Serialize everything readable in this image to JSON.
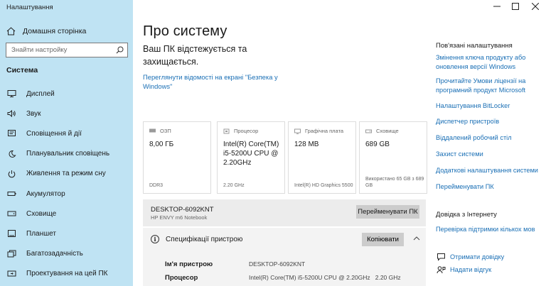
{
  "window": {
    "title": "Налаштування"
  },
  "sidebar": {
    "home_label": "Домашня сторінка",
    "search_placeholder": "Знайти настройку",
    "section_title": "Система",
    "items": [
      {
        "label": "Дисплей",
        "icon": "display-icon"
      },
      {
        "label": "Звук",
        "icon": "sound-icon"
      },
      {
        "label": "Сповіщення й дії",
        "icon": "notifications-icon"
      },
      {
        "label": "Планувальник сповіщень",
        "icon": "moon-icon"
      },
      {
        "label": "Живлення та режим сну",
        "icon": "power-icon"
      },
      {
        "label": "Акумулятор",
        "icon": "battery-icon"
      },
      {
        "label": "Сховище",
        "icon": "storage-icon"
      },
      {
        "label": "Планшет",
        "icon": "tablet-icon"
      },
      {
        "label": "Багатозадачність",
        "icon": "multitasking-icon"
      },
      {
        "label": "Проектування на цей ПК",
        "icon": "projecting-icon"
      }
    ]
  },
  "main": {
    "title": "Про систему",
    "protection_text": "Ваш ПК відстежується та захищається.",
    "security_link": "Переглянути відомості на екрані \"Безпека у Windows\"",
    "cards": [
      {
        "name": "ram",
        "icon": "ram-icon",
        "label": "ОЗП",
        "value": "8,00 ГБ",
        "footer": "DDR3"
      },
      {
        "name": "cpu",
        "icon": "processor-icon",
        "label": "Процесор",
        "value": "Intel(R) Core(TM) i5-5200U CPU @ 2.20GHz",
        "footer": "2.20 GHz"
      },
      {
        "name": "gpu",
        "icon": "graphics-card-icon",
        "label": "Графічна плата",
        "value": "128 MB",
        "footer": "Intel(R) HD Graphics 5500"
      },
      {
        "name": "storage",
        "icon": "drive-icon",
        "label": "Сховище",
        "value": "689 GB",
        "footer": "Використано 65 GB з 689 GB"
      }
    ],
    "device": {
      "name": "DESKTOP-6092KNT",
      "model": "HP ENVY m6 Notebook",
      "rename_label": "Перейменувати ПК"
    },
    "specs": {
      "title": "Специфікації пристрою",
      "copy_label": "Копіювати",
      "rows": [
        {
          "key": "Ім'я пристрою",
          "value": "DESKTOP-6092KNT"
        },
        {
          "key": "Процесор",
          "value": "Intel(R) Core(TM) i5-5200U CPU @ 2.20GHz   2.20 GHz"
        }
      ]
    }
  },
  "related": {
    "title": "Пов'язані налаштування",
    "links": [
      "Змінення ключа продукту або оновлення версії Windows",
      "Прочитайте Умови ліцензії на програмний продукт Microsoft",
      "Налаштування BitLocker",
      "Диспетчер пристроїв",
      "Віддалений робочий стіл",
      "Захист системи",
      "Додаткові налаштування системи",
      "Перейменувати ПК"
    ],
    "help_title": "Довідка з Інтернету",
    "help_link": "Перевірка підтримки кількох мов",
    "get_help": "Отримати довідку",
    "feedback": "Надати відгук"
  },
  "colors": {
    "sidebar_bg": "#bfe3f3",
    "link": "#1a6fb5",
    "button": "#cccccc"
  }
}
